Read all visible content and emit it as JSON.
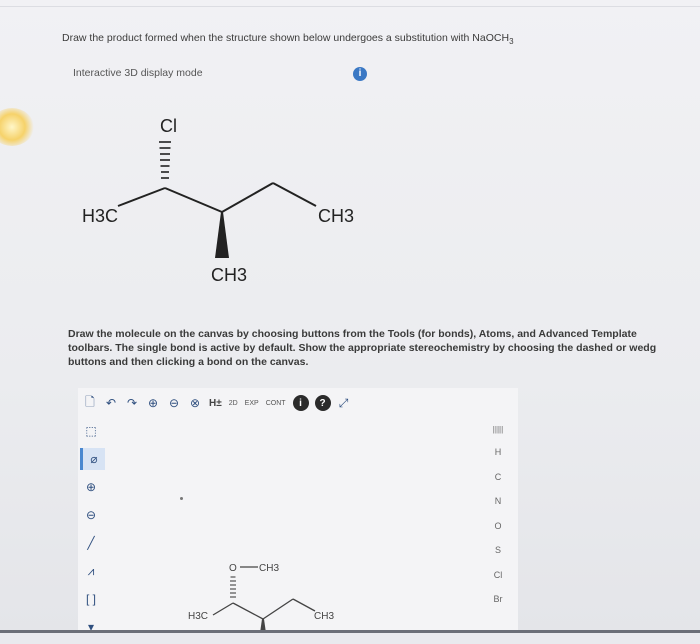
{
  "question": {
    "text": "Draw the product formed when the structure shown below undergoes a substitution with NaOCH",
    "subscript": "3"
  },
  "display_mode_label": "Interactive 3D display mode",
  "info_button_glyph": "i",
  "molecule": {
    "chlorine_label": "Cl",
    "left_methyl": "H3C",
    "right_methyl": "CH3",
    "bottom_methyl": "CH3"
  },
  "instructions": "Draw the molecule on the canvas by choosing buttons from the Tools (for bonds), Atoms, and Advanced Template\ntoolbars. The single bond is active by default. Show the appropriate stereochemistry by choosing the dashed or wedg\nbuttons and then clicking a bond on the canvas.",
  "toolbar_top": [
    {
      "name": "new-document-icon",
      "glyph": "🗋"
    },
    {
      "name": "undo-icon",
      "glyph": "↶"
    },
    {
      "name": "redo-icon",
      "glyph": "↷"
    },
    {
      "name": "zoom-in-icon",
      "glyph": "⊕"
    },
    {
      "name": "zoom-out-icon",
      "glyph": "⊖"
    },
    {
      "name": "clear-icon",
      "glyph": "⊗"
    }
  ],
  "toolbar_top_text": {
    "hydrogen": "H±",
    "two_d": "2D",
    "exp": "EXP",
    "cont": "CONT",
    "help": "?",
    "fullscreen": "⤢"
  },
  "toolbar_left": [
    {
      "name": "select-tool-icon",
      "glyph": "⬚"
    },
    {
      "name": "eraser-tool-icon",
      "glyph": "⌀",
      "active": true
    },
    {
      "name": "positive-charge-icon",
      "glyph": "⊕"
    },
    {
      "name": "negative-charge-icon",
      "glyph": "⊖"
    },
    {
      "name": "single-bond-icon",
      "glyph": "╱"
    },
    {
      "name": "chain-tool-icon",
      "glyph": "⩘"
    },
    {
      "name": "bracket-tool-icon",
      "glyph": "[ ]"
    },
    {
      "name": "template-tool-icon",
      "glyph": "▾"
    }
  ],
  "atoms_header": "|||||",
  "atoms": [
    "H",
    "C",
    "N",
    "O",
    "S",
    "Cl",
    "Br"
  ],
  "canvas_drawing": {
    "oxygen": "O",
    "methyl_on_oxygen": "CH3",
    "left_methyl": "H3C",
    "right_methyl": "CH3"
  },
  "colors": {
    "accent": "#3a78c4",
    "toolbar_icon": "#2f4f7f"
  }
}
